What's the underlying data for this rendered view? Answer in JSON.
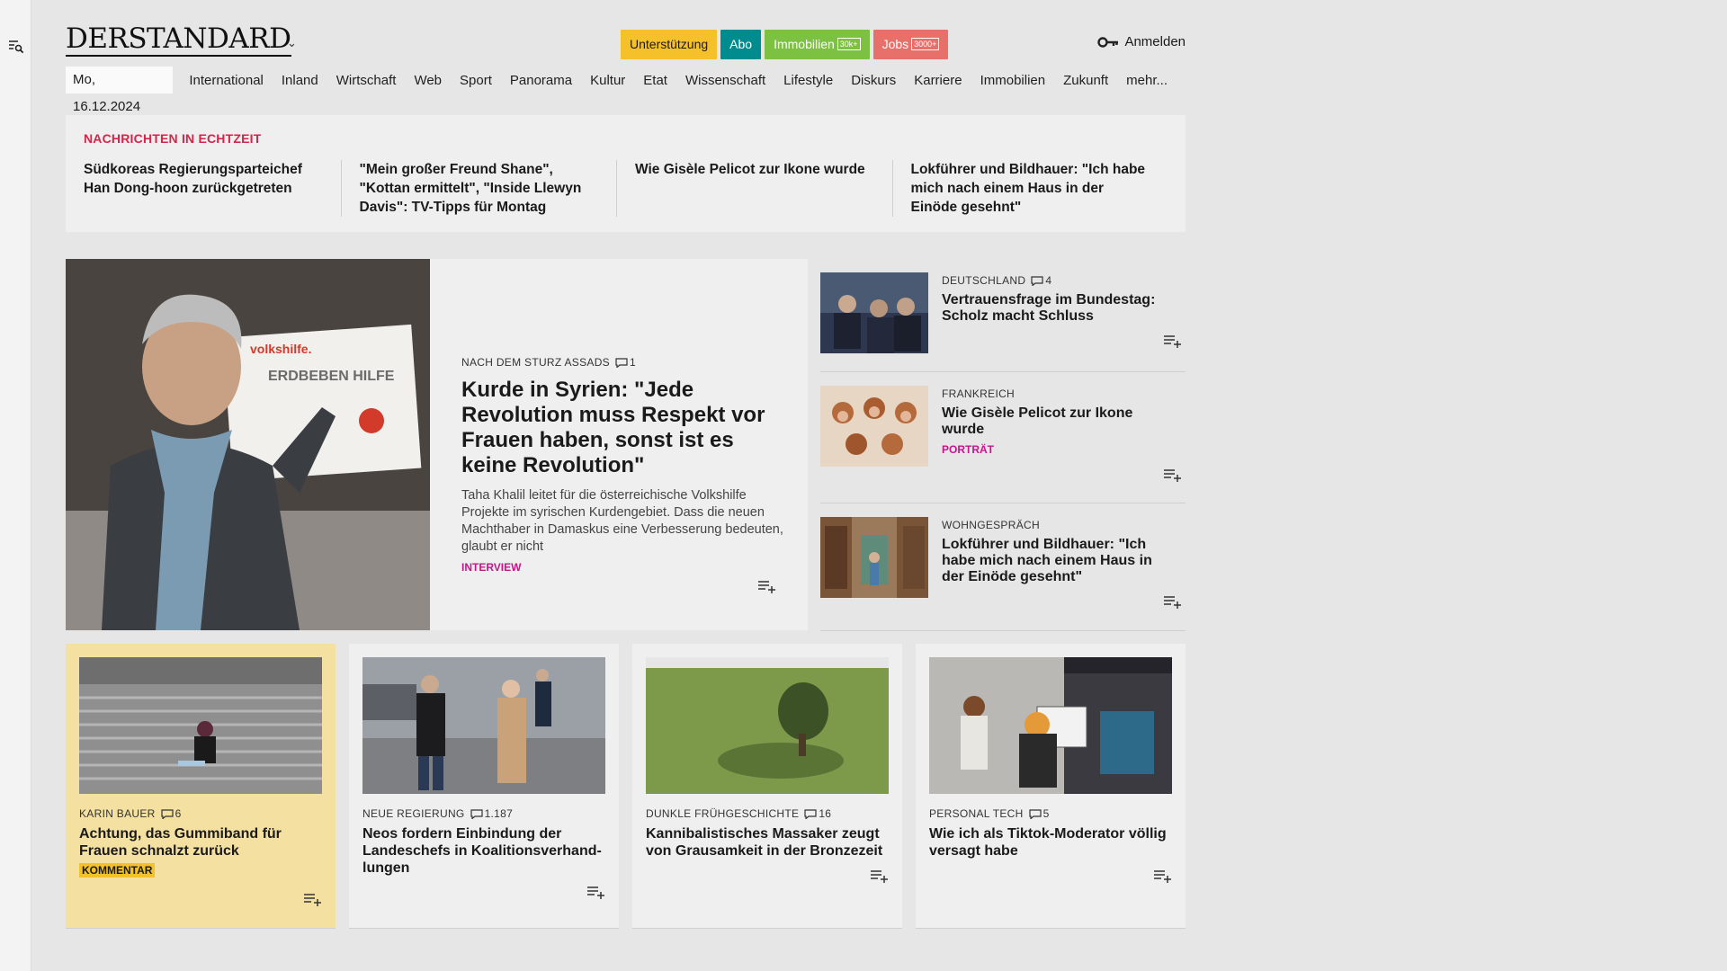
{
  "header": {
    "logo": "DERSTANDARD",
    "buttons": {
      "support": "Unterstützung",
      "abo": "Abo",
      "immobilien": "Immobilien",
      "immobilien_badge": "30k+",
      "jobs": "Jobs",
      "jobs_badge": "3000+"
    },
    "login": "Anmelden"
  },
  "nav": {
    "date": "Mo, 16.12.2024",
    "items": [
      "International",
      "Inland",
      "Wirtschaft",
      "Web",
      "Sport",
      "Panorama",
      "Kultur",
      "Etat",
      "Wissenschaft",
      "Lifestyle",
      "Diskurs",
      "Karriere",
      "Immobilien",
      "Zukunft",
      "mehr..."
    ]
  },
  "ticker": {
    "title": "NACHRICHTEN IN ECHTZEIT",
    "items": [
      "Südkoreas Regierungsparteichef Han Dong-hoon zurückgetreten",
      "\"Mein großer Freund Shane\", \"Kottan ermittelt\", \"Inside Llewyn Davis\": TV-Tipps für Montag",
      "Wie Gisèle Pelicot zur Ikone wurde",
      "Lokführer und Bildhauer: \"Ich habe mich nach einem Haus in der Einöde gesehnt\""
    ]
  },
  "hero": {
    "kicker": "NACH DEM STURZ ASSADS",
    "comments": "1",
    "title": "Kurde in Syrien: \"Jede Revolution muss Respekt vor Frauen haben, sonst ist es keine Revolution\"",
    "lead": "Taha Khalil leitet für die österreichische Volkshilfe Projekte im syrischen Kurdengebiet. Dass die neuen Machthaber in Damaskus eine Verbesserung bedeuten, glaubt er nicht",
    "tag": "INTERVIEW",
    "image_sign_text": "volkshilfe. ERDBEBEN HILFE"
  },
  "side": [
    {
      "kicker": "DEUTSCHLAND",
      "comments": "4",
      "title": "Vertrauensfrage im Bundestag: Scholz macht Schluss",
      "tag": ""
    },
    {
      "kicker": "FRANKREICH",
      "comments": "",
      "title": "Wie Gisèle Pelicot zur Ikone wurde",
      "tag": "PORTRÄT"
    },
    {
      "kicker": "WOHNGESPRÄCH",
      "comments": "",
      "title": "Lokführer und Bildhauer: \"Ich habe mich nach einem Haus in der Einöde gesehnt\"",
      "tag": ""
    }
  ],
  "cards": [
    {
      "kicker": "KARIN BAUER",
      "comments": "6",
      "title": "Achtung, das Gummiband für Frauen schnalzt zurück",
      "tag": "KOMMENTAR"
    },
    {
      "kicker": "NEUE REGIERUNG",
      "comments": "1.187",
      "title": "Neos fordern Einbindung der Landeschefs in Koalitionsverhand-lungen",
      "tag": ""
    },
    {
      "kicker": "DUNKLE FRÜHGESCHICHTE",
      "comments": "16",
      "title": "Kannibalistisches Massaker zeugt von Grausamkeit in der Bronzezeit",
      "tag": ""
    },
    {
      "kicker": "PERSONAL TECH",
      "comments": "5",
      "title": "Wie ich als Tiktok-Moderator völlig versagt habe",
      "tag": ""
    }
  ],
  "icons": {
    "rail": "search-menu-icon",
    "login": "key-icon",
    "comment": "comment-icon",
    "save": "playlist-add-icon"
  },
  "colors": {
    "ticker_title": "#d6254b",
    "tag_magenta": "#c5168c",
    "support": "#f4c12a",
    "abo": "#008b8f",
    "immobilien": "#7cc142",
    "jobs": "#e8706b",
    "highlight_card": "#f4e0a0"
  }
}
